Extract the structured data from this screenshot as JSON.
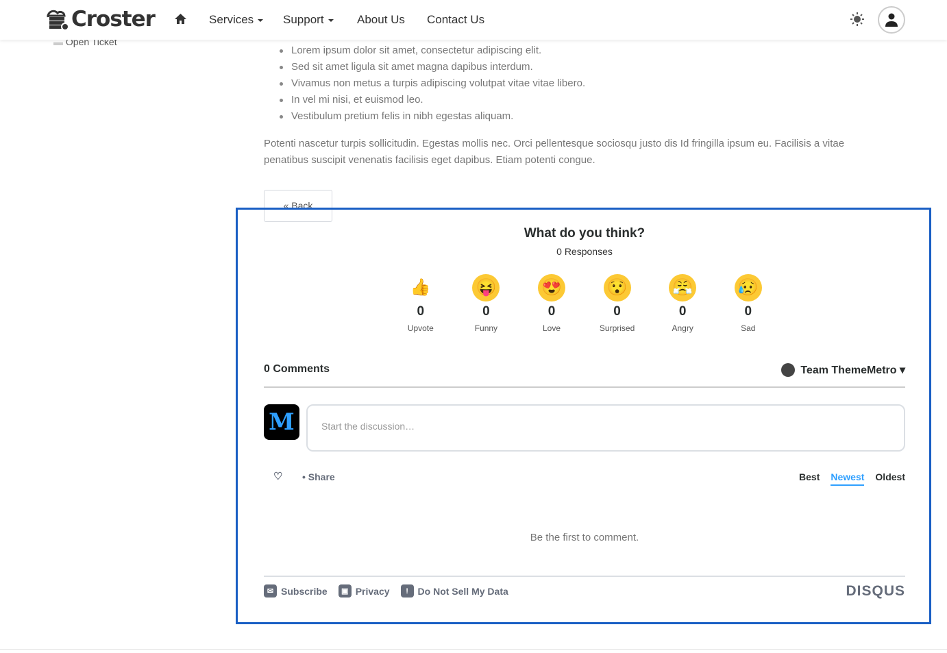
{
  "nav": {
    "brand": "Croster",
    "items": [
      "Services",
      "Support",
      "About Us",
      "Contact Us"
    ]
  },
  "sidebar": {
    "open_ticket": "Open Ticket"
  },
  "content": {
    "bullets": [
      "Lorem ipsum dolor sit amet, consectetur adipiscing elit.",
      "Sed sit amet ligula sit amet magna dapibus interdum.",
      "Vivamus non metus a turpis adipiscing volutpat vitae vitae libero.",
      "In vel mi nisi, et euismod leo.",
      "Vestibulum pretium felis in nibh egestas aliquam."
    ],
    "paragraph": "Potenti nascetur turpis sollicitudin. Egestas mollis nec. Orci pellentesque sociosqu justo dis Id fringilla ipsum eu. Facilisis a vitae penatibus suscipit venenatis facilisis eget dapibus. Etiam potenti congue.",
    "back": "« Back"
  },
  "disqus": {
    "question": "What do you think?",
    "responses": "0 Responses",
    "reactions": [
      {
        "label": "Upvote",
        "count": "0",
        "emoji": "👍"
      },
      {
        "label": "Funny",
        "count": "0",
        "emoji": "😝"
      },
      {
        "label": "Love",
        "count": "0",
        "emoji": "😍"
      },
      {
        "label": "Surprised",
        "count": "0",
        "emoji": "😯"
      },
      {
        "label": "Angry",
        "count": "0",
        "emoji": "😤"
      },
      {
        "label": "Sad",
        "count": "0",
        "emoji": "😥"
      }
    ],
    "comments": "0 Comments",
    "user": "Team ThemeMetro ▾",
    "placeholder": "Start the discussion…",
    "share": "Share",
    "sorts": [
      "Best",
      "Newest",
      "Oldest"
    ],
    "active_sort": "Newest",
    "empty": "Be the first to comment.",
    "footer": [
      "Subscribe",
      "Privacy",
      "Do Not Sell My Data"
    ],
    "brand": "DISQUS",
    "accent": "#2e9fff"
  }
}
